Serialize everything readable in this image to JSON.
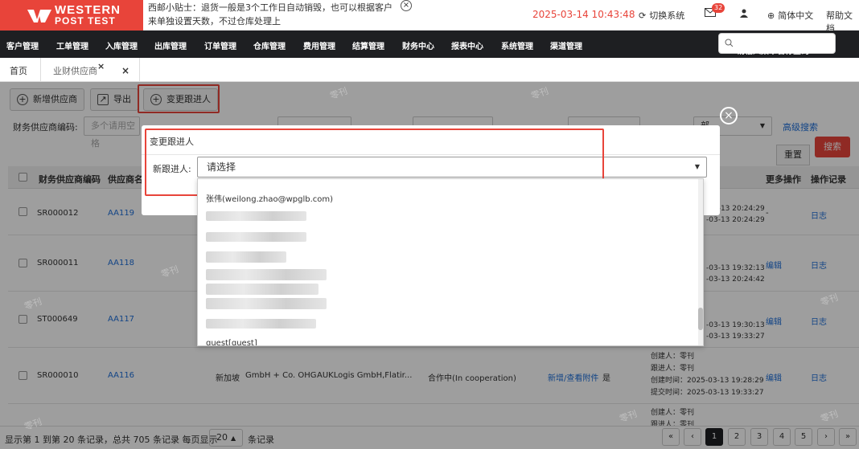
{
  "brand": {
    "line1": "WESTERN",
    "line2": "POST TEST"
  },
  "tip": {
    "text": "西邮小贴士：退货一般是3个工作日自动销毁，也可以根据客户来单独设置天数，不过仓库处理上"
  },
  "header": {
    "datetime": "2025-03-14 10:43:48",
    "switch_system": "切换系统",
    "notification_count": "32",
    "language": "简体中文",
    "help": "帮助文档"
  },
  "nav": {
    "items": [
      "客户管理",
      "工单管理",
      "入库管理",
      "出库管理",
      "订单管理",
      "仓库管理",
      "费用管理",
      "结算管理",
      "财务中心",
      "报表中心",
      "系统管理",
      "渠道管理"
    ],
    "search_placeholder": "请输入菜单名称查询"
  },
  "tabs": {
    "home": "首页",
    "current": "业财供应商"
  },
  "toolbar": {
    "add": "新增供应商",
    "export": "导出",
    "change_follower": "变更跟进人"
  },
  "filters": {
    "supplier_code_label": "财务供应商编码:",
    "supplier_code_placeholder": "多个请用空格",
    "advanced": "高级搜索",
    "reset": "重置",
    "search": "搜索",
    "select_value": "部"
  },
  "table": {
    "headers": [
      "财务供应商编码",
      "供应商名",
      "更多操作",
      "操作记录"
    ],
    "rows": [
      {
        "code": "SR000012",
        "name": "AA119",
        "t1": "-03-13 20:24:29",
        "t2": "-03-13 20:24:29",
        "more": "-",
        "log": "日志"
      },
      {
        "code": "SR000011",
        "name": "AA118",
        "t1": "-03-13 19:32:13",
        "t2": "-03-13 20:24:42",
        "more": "编辑",
        "log": "日志"
      },
      {
        "code": "ST000649",
        "name": "AA117",
        "t1": "-03-13 19:30:13",
        "t2": "-03-13 19:33:27",
        "more": "编辑",
        "log": "日志"
      },
      {
        "code": "SR000010",
        "name": "AA116",
        "country": "新加坡",
        "company": "GmbH + Co. OHG",
        "address": "AUKLogis GmbH,Flatir...",
        "status": "合作中(In cooperation)",
        "attach": "新增/查看附件",
        "flag": "是",
        "created_by": "创建人：零刊",
        "follower": "跟进人：零刊",
        "created_time": "创建时间：2025-03-13 19:28:29",
        "submit_time": "提交时间：2025-03-13 19:33:27",
        "more": "编辑",
        "log": "日志"
      }
    ],
    "row5_created_by": "创建人：零刊",
    "row5_follower": "跟进人：零刊"
  },
  "footer": {
    "summary": "显示第 1 到第 20 条记录，总共 705 条记录 每页显示",
    "page_size": "20",
    "unit": "条记录",
    "pages": [
      "«",
      "‹",
      "1",
      "2",
      "3",
      "4",
      "5",
      "›",
      "»"
    ]
  },
  "modal": {
    "title": "变更跟进人",
    "field_label": "新跟进人:",
    "select_placeholder": "请选择",
    "options": [
      "张伟(weilong.zhao@wpglb.com)",
      "guest[guest]"
    ]
  },
  "watermark": "零刊"
}
